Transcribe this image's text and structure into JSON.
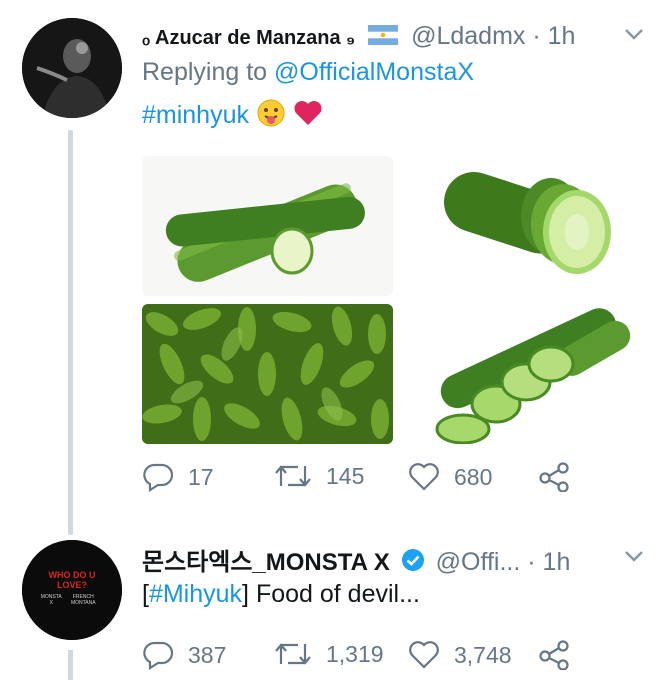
{
  "tweets": [
    {
      "display_name": "ₒ Azucar de Manzana ₉",
      "handle": "@Ldadmx",
      "time": "· 1h",
      "reply_prefix": "Replying to",
      "reply_to": "@OfficialMonstaX",
      "text_hashtag": "#minhyuk",
      "emojis": [
        "tongue-face",
        "red-heart"
      ],
      "flag": "argentina",
      "media": [
        "cucumber-photo-1",
        "cucumber-photo-2",
        "cucumber-photo-3",
        "cucumber-photo-4"
      ],
      "actions": {
        "replies": "17",
        "retweets": "145",
        "likes": "680"
      }
    },
    {
      "display_name": "몬스타엑스_MONSTA X",
      "verified": true,
      "handle": "@Offi...",
      "time": "· 1h",
      "text_bracket_open": "[",
      "text_hashtag": "#Mihyuk",
      "text_bracket_close": "]",
      "text_body": " Food of devil...",
      "avatar_text": {
        "title": "WHO DO U LOVE?",
        "band": "MONSTA X",
        "subtitle": "FRENCH MONTANA"
      },
      "actions": {
        "replies": "387",
        "retweets": "1,319",
        "likes": "3,748"
      }
    }
  ],
  "colors": {
    "link": "#1b95e0",
    "meta": "#657786",
    "thread": "#cfd9de",
    "heart": "#e0245e",
    "verified": "#1da1f2"
  }
}
